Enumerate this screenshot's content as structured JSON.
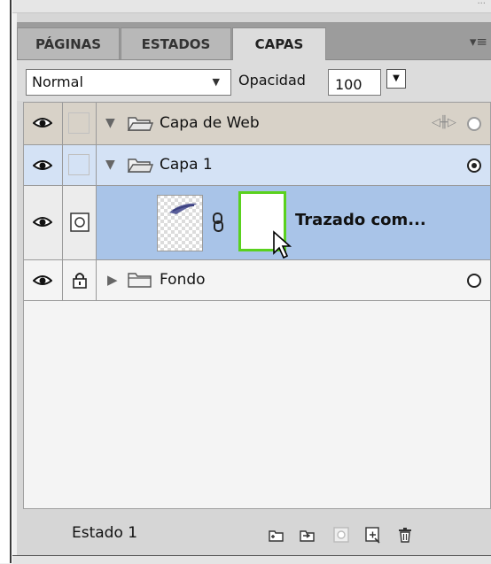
{
  "tabs": [
    {
      "label": "PÁGINAS"
    },
    {
      "label": "ESTADOS"
    },
    {
      "label": "CAPAS"
    }
  ],
  "controls": {
    "blend_mode": "Normal",
    "opacity_label": "Opacidad",
    "opacity_value": "100"
  },
  "layers": [
    {
      "name": "Capa de Web",
      "type": "folder",
      "expanded": true,
      "visible": true,
      "locked": false,
      "selected": false
    },
    {
      "name": "Capa 1",
      "type": "folder",
      "expanded": true,
      "visible": true,
      "locked": false,
      "selected": true
    },
    {
      "name": "Trazado com...",
      "type": "object",
      "visible": true,
      "locked": false,
      "selected": true
    },
    {
      "name": "Fondo",
      "type": "folder",
      "expanded": false,
      "visible": true,
      "locked": true,
      "selected": false
    }
  ],
  "footer": {
    "state_label": "Estado 1"
  },
  "colors": {
    "selected_row": "#a9c4e8",
    "highlight_row": "#d4e2f5",
    "web_layer_row": "#d8d2c8",
    "mask_border": "#5ad11e",
    "thumb_stroke": "#5a5f9a"
  },
  "icons": [
    "eye-icon",
    "lock-icon",
    "folder-icon",
    "chain-link-icon",
    "cursor-arrow-icon",
    "new-folder-icon",
    "add-layer-icon",
    "mask-icon",
    "new-state-icon",
    "trash-icon",
    "panel-menu-icon"
  ]
}
